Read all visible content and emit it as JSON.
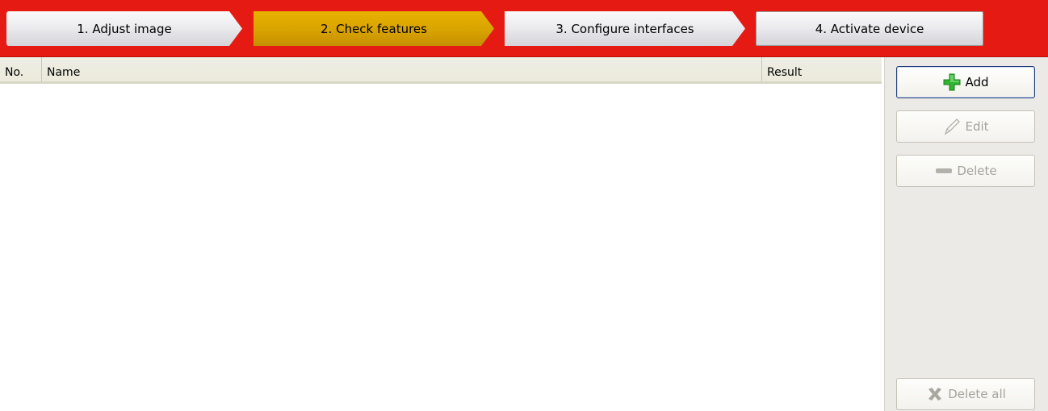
{
  "wizard": {
    "steps": [
      {
        "label": "1. Adjust image",
        "state": "normal"
      },
      {
        "label": "2. Check features",
        "state": "active"
      },
      {
        "label": "3. Configure interfaces",
        "state": "normal"
      },
      {
        "label": "4. Activate device",
        "state": "normal"
      }
    ],
    "bar_color": "#e51a12",
    "active_color": "#d9a300"
  },
  "table": {
    "columns": [
      "No.",
      "Name",
      "Result"
    ],
    "rows": []
  },
  "actions": {
    "add_label": "Add",
    "edit_label": "Edit",
    "delete_label": "Delete",
    "delete_all_label": "Delete all",
    "icons": {
      "add": "plus-icon",
      "edit": "pencil-icon",
      "delete": "minus-icon",
      "delete_all": "x-icon"
    }
  }
}
